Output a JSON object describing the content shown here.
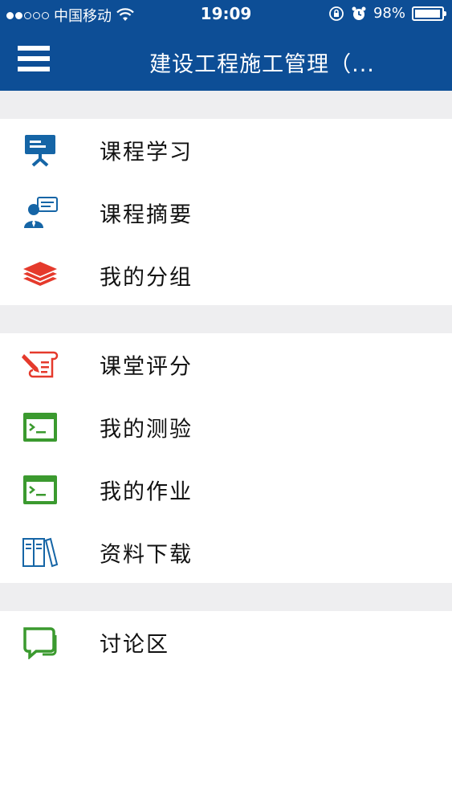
{
  "status_bar": {
    "carrier": "中国移动",
    "time": "19:09",
    "battery": "98%",
    "battery_level": 0.98
  },
  "header": {
    "title": "建设工程施工管理（..."
  },
  "colors": {
    "header_bg": "#0d4e96",
    "blue_icon": "#1565a6",
    "red_icon": "#e53a2c",
    "green_icon": "#3b9a2f"
  },
  "sections": [
    {
      "items": [
        {
          "label": "课程学习",
          "icon": "presentation-board-icon"
        },
        {
          "label": "课程摘要",
          "icon": "speaker-chat-icon"
        },
        {
          "label": "我的分组",
          "icon": "layers-stack-icon"
        }
      ]
    },
    {
      "items": [
        {
          "label": "课堂评分",
          "icon": "pen-scroll-icon"
        },
        {
          "label": "我的测验",
          "icon": "terminal-icon"
        },
        {
          "label": "我的作业",
          "icon": "terminal-icon"
        },
        {
          "label": "资料下载",
          "icon": "books-icon"
        }
      ]
    },
    {
      "items": [
        {
          "label": "讨论区",
          "icon": "chat-bubble-icon"
        }
      ]
    }
  ]
}
